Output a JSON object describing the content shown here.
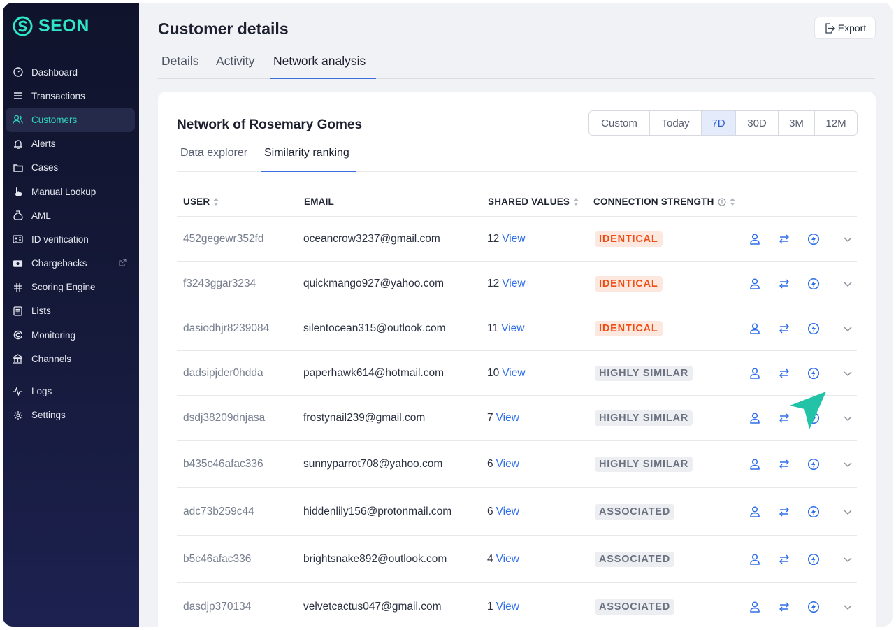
{
  "brand": {
    "name": "SEON",
    "accent": "#2ee6c8"
  },
  "sidebar": {
    "items": [
      {
        "label": "Dashboard",
        "icon": "dashboard-icon"
      },
      {
        "label": "Transactions",
        "icon": "list-icon"
      },
      {
        "label": "Customers",
        "icon": "users-icon",
        "active": true
      },
      {
        "label": "Alerts",
        "icon": "alert-icon"
      },
      {
        "label": "Cases",
        "icon": "folder-icon"
      },
      {
        "label": "Manual Lookup",
        "icon": "hand-pointer-icon"
      },
      {
        "label": "AML",
        "icon": "money-bag-icon"
      },
      {
        "label": "ID verification",
        "icon": "id-card-icon"
      },
      {
        "label": "Chargebacks",
        "icon": "banknote-icon",
        "external": true
      },
      {
        "label": "Scoring Engine",
        "icon": "scoring-icon"
      },
      {
        "label": "Lists",
        "icon": "list-box-icon"
      },
      {
        "label": "Monitoring",
        "icon": "monitoring-icon"
      },
      {
        "label": "Channels",
        "icon": "channels-icon"
      },
      {
        "label": "Logs",
        "icon": "pulse-icon"
      },
      {
        "label": "Settings",
        "icon": "gear-icon"
      }
    ]
  },
  "header": {
    "title": "Customer details",
    "export_label": "Export",
    "tabs": [
      {
        "label": "Details"
      },
      {
        "label": "Activity"
      },
      {
        "label": "Network analysis",
        "active": true
      }
    ]
  },
  "network": {
    "title": "Network of Rosemary Gomes",
    "ranges": [
      {
        "label": "Custom"
      },
      {
        "label": "Today"
      },
      {
        "label": "7D",
        "active": true
      },
      {
        "label": "30D"
      },
      {
        "label": "3M"
      },
      {
        "label": "12M"
      }
    ],
    "subtabs": [
      {
        "label": "Data explorer"
      },
      {
        "label": "Similarity ranking",
        "active": true
      }
    ],
    "columns": {
      "user": "USER",
      "email": "EMAIL",
      "shared": "SHARED VALUES",
      "strength": "CONNECTION STRENGTH"
    },
    "view_label": "View",
    "rows": [
      {
        "user": "452gegewr352fd",
        "email": "oceancrow3237@gmail.com",
        "shared": "12",
        "strength": "IDENTICAL",
        "level": "red"
      },
      {
        "user": "f3243ggar3234",
        "email": "quickmango927@yahoo.com",
        "shared": "12",
        "strength": "IDENTICAL",
        "level": "red"
      },
      {
        "user": "dasiodhjr8239084",
        "email": "silentocean315@outlook.com",
        "shared": "11",
        "strength": "IDENTICAL",
        "level": "red"
      },
      {
        "user": "dadsipjder0hdda",
        "email": "paperhawk614@hotmail.com",
        "shared": "10",
        "strength": "HIGHLY SIMILAR",
        "level": "gray"
      },
      {
        "user": "dsdj38209dnjasa",
        "email": "frostynail239@gmail.com",
        "shared": "7",
        "strength": "HIGHLY SIMILAR",
        "level": "gray"
      },
      {
        "user": "b435c46afac336",
        "email": "sunnyparrot708@yahoo.com",
        "shared": "6",
        "strength": "HIGHLY SIMILAR",
        "level": "gray"
      },
      {
        "user": "adc73b259c44",
        "email": "hiddenlily156@protonmail.com",
        "shared": "6",
        "strength": "ASSOCIATED",
        "level": "gray"
      },
      {
        "user": "b5c46afac336",
        "email": "brightsnake892@outlook.com",
        "shared": "4",
        "strength": "ASSOCIATED",
        "level": "gray"
      },
      {
        "user": "dasdjp370134",
        "email": "velvetcactus047@gmail.com",
        "shared": "1",
        "strength": "ASSOCIATED",
        "level": "gray"
      }
    ]
  },
  "colors": {
    "primary": "#3b6fe0",
    "identical": "#f04d14",
    "cursor": "#22c3a6"
  }
}
